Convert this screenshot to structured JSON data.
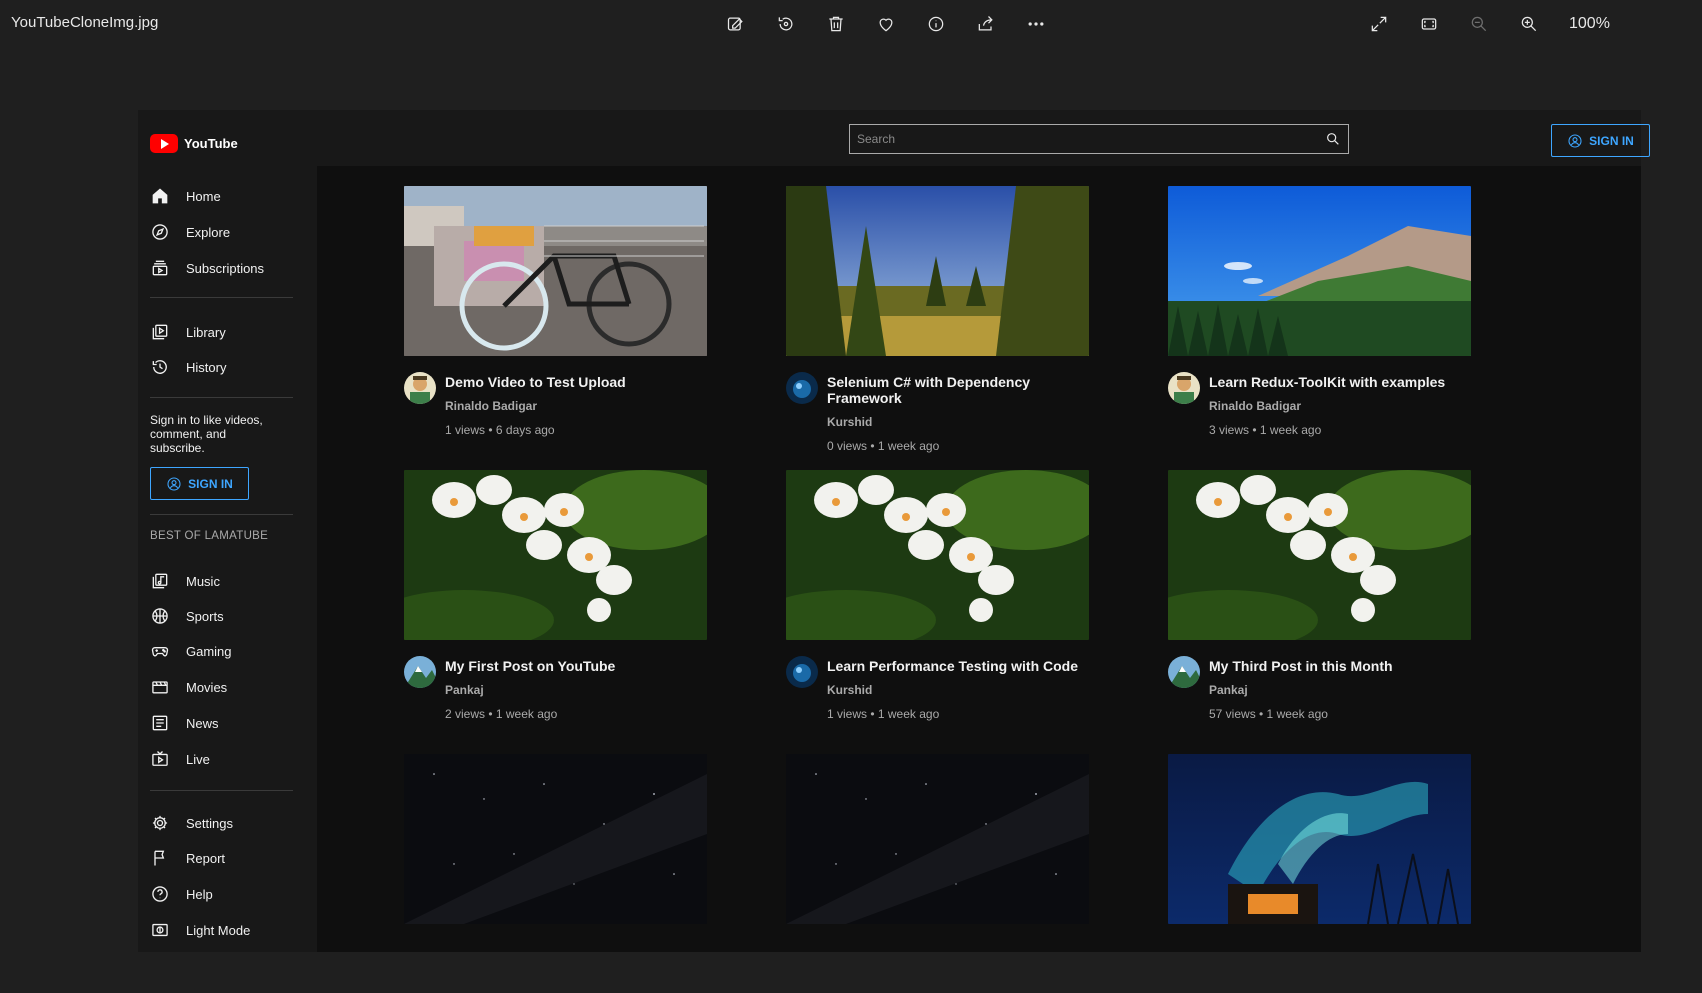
{
  "viewer": {
    "filename": "YouTubeCloneImg.jpg",
    "zoom": "100%"
  },
  "app": {
    "brand": "YouTube",
    "search": {
      "placeholder": "Search"
    },
    "header_signin": "SIGN IN",
    "nav": {
      "home": "Home",
      "explore": "Explore",
      "subscriptions": "Subscriptions",
      "library": "Library",
      "history": "History"
    },
    "signin_prompt": "Sign in to like videos, comment, and subscribe.",
    "sidebar_signin": "SIGN IN",
    "section_title": "BEST OF LAMATUBE",
    "best": {
      "music": "Music",
      "sports": "Sports",
      "gaming": "Gaming",
      "movies": "Movies",
      "news": "News",
      "live": "Live"
    },
    "footer_nav": {
      "settings": "Settings",
      "report": "Report",
      "help": "Help",
      "light_mode": "Light Mode"
    }
  },
  "videos": [
    {
      "title": "Demo Video to Test Upload",
      "channel": "Rinaldo Badigar",
      "stats": "1 views • 6 days ago",
      "thumb": "bike"
    },
    {
      "title": "Selenium C# with Dependency Framework",
      "channel": "Kurshid",
      "stats": "0 views • 1 week ago",
      "thumb": "forest"
    },
    {
      "title": "Learn Redux-ToolKit with examples",
      "channel": "Rinaldo Badigar",
      "stats": "3 views • 1 week ago",
      "thumb": "mountain"
    },
    {
      "title": "My First Post on YouTube",
      "channel": "Pankaj",
      "stats": "2 views • 1 week ago",
      "thumb": "orchid"
    },
    {
      "title": "Learn Performance Testing with Code",
      "channel": "Kurshid",
      "stats": "1 views • 1 week ago",
      "thumb": "orchid"
    },
    {
      "title": "My Third Post in this Month",
      "channel": "Pankaj",
      "stats": "57 views • 1 week ago",
      "thumb": "orchid"
    },
    {
      "thumb": "stars"
    },
    {
      "thumb": "stars"
    },
    {
      "thumb": "aurora"
    }
  ]
}
